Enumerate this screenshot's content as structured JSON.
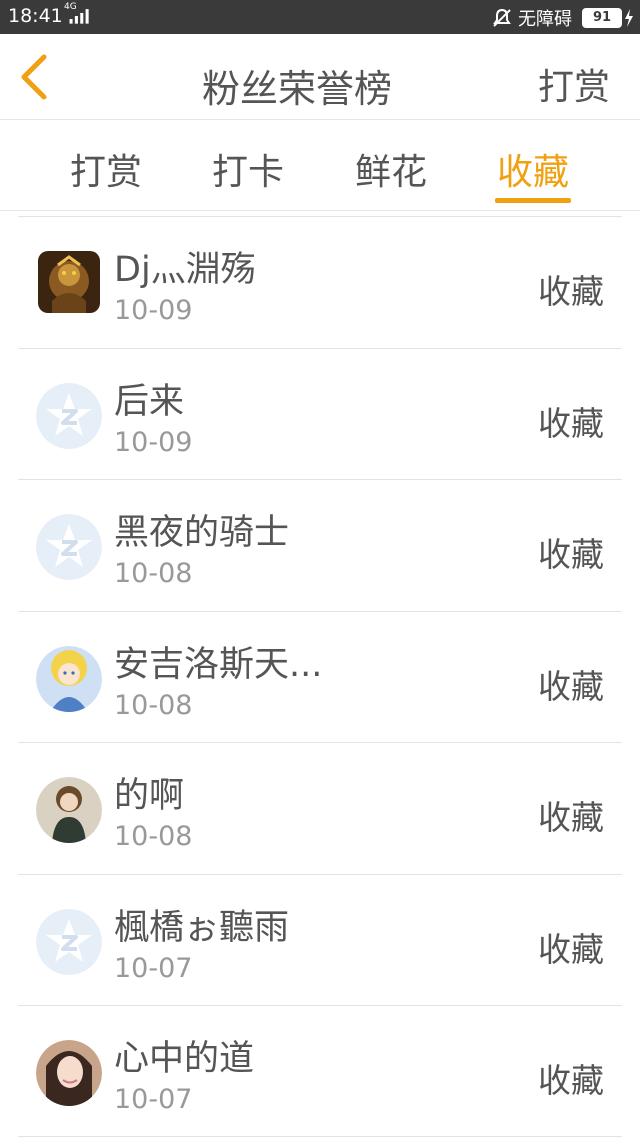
{
  "status_bar": {
    "time": "18:41",
    "network": "4G",
    "mode_label": "无障碍",
    "battery": "91"
  },
  "header": {
    "title": "粉丝荣誉榜",
    "action_label": "打赏"
  },
  "tabs": [
    {
      "label": "打赏"
    },
    {
      "label": "打卡"
    },
    {
      "label": "鲜花"
    },
    {
      "label": "收藏"
    }
  ],
  "accent_color": "#f0a010",
  "fans": [
    {
      "name": "Dj灬淵殇",
      "date": "10-09",
      "action": "收藏",
      "avatar": "warrior-avatar"
    },
    {
      "name": "后来",
      "date": "10-09",
      "action": "收藏",
      "avatar": "default-qq-avatar"
    },
    {
      "name": "黑夜的骑士",
      "date": "10-08",
      "action": "收藏",
      "avatar": "default-qq-avatar"
    },
    {
      "name": "安吉洛斯天...",
      "date": "10-08",
      "action": "收藏",
      "avatar": "anime-girl-avatar"
    },
    {
      "name": "的啊",
      "date": "10-08",
      "action": "收藏",
      "avatar": "girl-photo-avatar"
    },
    {
      "name": "楓橋ぉ聽雨",
      "date": "10-07",
      "action": "收藏",
      "avatar": "default-qq-avatar"
    },
    {
      "name": "心中的道",
      "date": "10-07",
      "action": "收藏",
      "avatar": "selfie-photo-avatar"
    }
  ]
}
